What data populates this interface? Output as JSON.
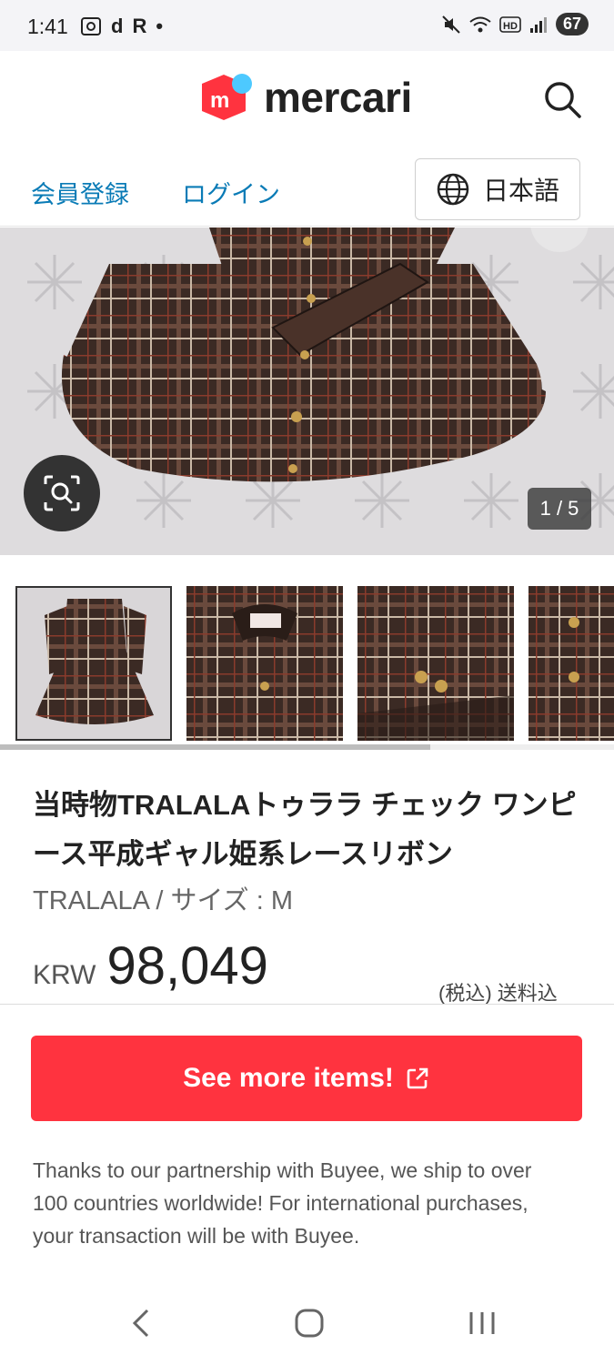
{
  "status_bar": {
    "time": "1:41",
    "left_icons": [
      "screenshot-icon",
      "d",
      "R",
      "•"
    ],
    "battery": "67"
  },
  "header": {
    "logo_text": "mercari",
    "logo_badge": "m"
  },
  "nav": {
    "register": "会員登録",
    "login": "ログイン",
    "language": "日本語"
  },
  "image_viewer": {
    "counter": "1 / 5",
    "thumbnail_count": 4,
    "scroll_progress": 0.7
  },
  "product": {
    "title": "当時物TRALALAトゥララ チェック ワンピース平成ギャル姫系レースリボン",
    "brand_size": "TRALALA / サイズ : M",
    "currency": "KRW",
    "price": "98,049",
    "tax_note": "(税込) 送料込"
  },
  "cta": {
    "label": "See more items!"
  },
  "partner_note": "Thanks to our partnership with Buyee, we ship to over 100 countries worldwide! For international purchases, your transaction will be with Buyee.",
  "colors": {
    "accent_red": "#ff333f",
    "link_blue": "#0a7bb6",
    "plaid_brown": "#3b2a24"
  }
}
